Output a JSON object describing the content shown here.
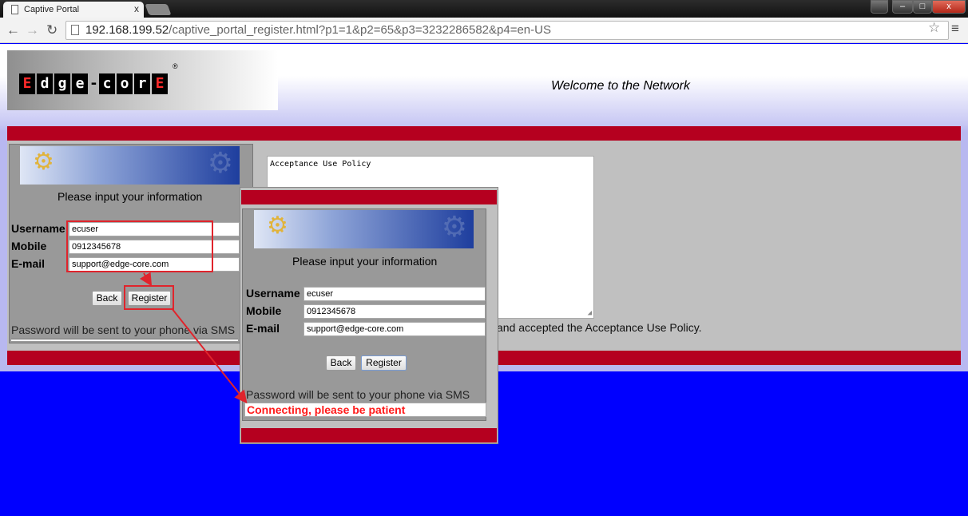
{
  "browser": {
    "tab_title": "Captive Portal",
    "tab_close": "x",
    "url_host": "192.168.199.52",
    "url_path": "/captive_portal_register.html?p1=1&p2=65&p3=3232286582&p4=en-US",
    "back_glyph": "←",
    "forward_glyph": "→",
    "reload_glyph": "↻",
    "star_glyph": "☆",
    "menu_glyph": "≡",
    "window_min": "–",
    "window_max": "□",
    "window_close": "x"
  },
  "header": {
    "logo_letters": [
      "E",
      "d",
      "g",
      "e",
      "-",
      "c",
      "o",
      "r",
      "E"
    ],
    "registered_mark": "®",
    "welcome": "Welcome to the Network"
  },
  "form": {
    "title": "Please input your information",
    "username_label": "Username",
    "mobile_label": "Mobile",
    "email_label": "E-mail",
    "username_value": "ecuser",
    "mobile_value": "0912345678",
    "email_value": "support@edge-core.com",
    "back_label": "Back",
    "register_label": "Register",
    "sms_note": "Password will be sent to your phone via SMS"
  },
  "policy": {
    "text": "Acceptance Use Policy",
    "accepted_text": "and accepted the Acceptance Use Policy."
  },
  "status": {
    "connecting": "Connecting, please be patient"
  },
  "icons": [
    "document-icon",
    "keys-icon",
    "star-icon",
    "menu-icon"
  ],
  "colors": {
    "accent_red": "#b5001f",
    "page_blue": "#0000ff",
    "annotation_red": "#e0242c",
    "status_red": "#ff1a1a"
  }
}
